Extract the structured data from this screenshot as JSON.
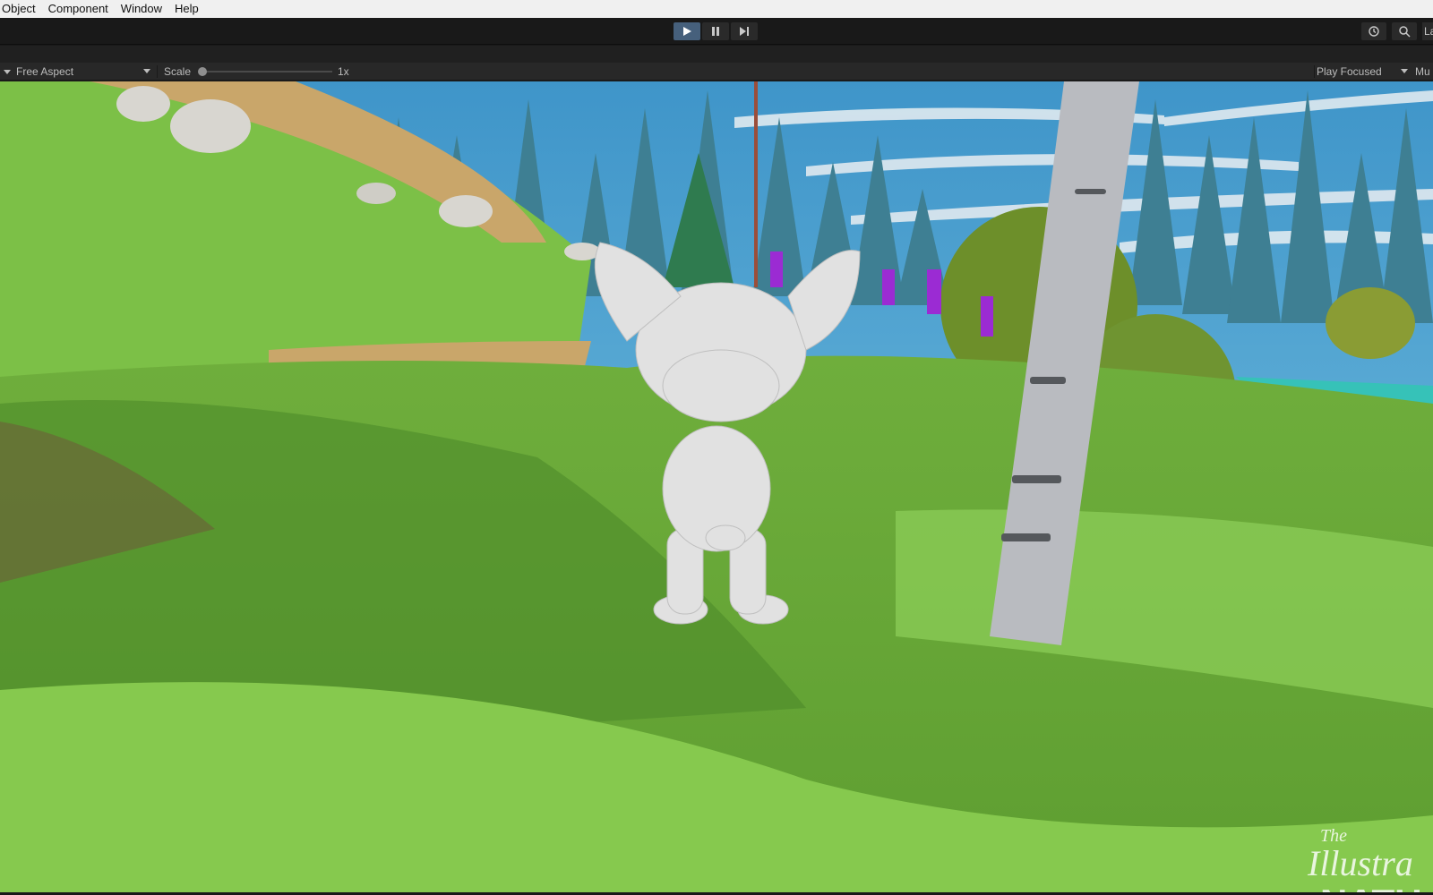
{
  "menubar": {
    "items": [
      "Object",
      "Component",
      "Window",
      "Help"
    ]
  },
  "toolbar": {
    "play_icon": "play-icon",
    "pause_icon": "pause-icon",
    "step_icon": "step-icon",
    "history_icon": "history-icon",
    "search_icon": "search-icon",
    "layout_label_partial": "La"
  },
  "game_view": {
    "aspect_label": "Free Aspect",
    "scale_label": "Scale",
    "scale_value": "1x",
    "scale_slider_level": 0,
    "play_mode_label": "Play Focused",
    "mute_label_partial": "Mu"
  },
  "colors": {
    "play_active": "#46607c",
    "toolbar_bg": "#191919",
    "gamebar_bg": "#282828",
    "grass": "#7bbd45",
    "sky": "#3b8fc4"
  },
  "scene": {
    "watermark_line1": "The",
    "watermark_line2": "Illustra",
    "watermark_line3": "NATU"
  }
}
